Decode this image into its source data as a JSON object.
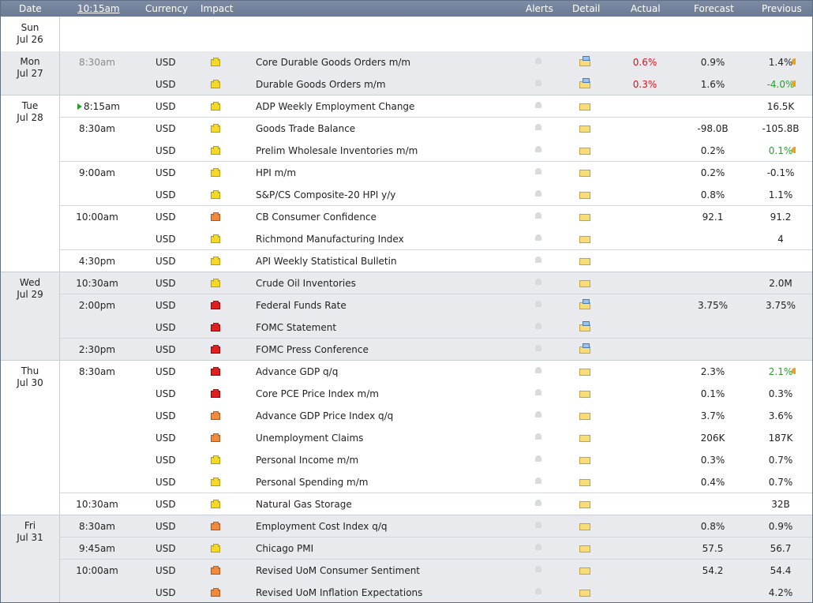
{
  "header": {
    "date": "Date",
    "time": "10:15am",
    "currency": "Currency",
    "impact": "Impact",
    "alerts": "Alerts",
    "detail": "Detail",
    "actual": "Actual",
    "forecast": "Forecast",
    "previous": "Previous"
  },
  "colors": {
    "header_bg": "#7586a0",
    "shade": "#e8eaee",
    "white": "#ffffff",
    "better": "#2aa02a",
    "worse": "#d8141e"
  },
  "days": [
    {
      "day": "Sun",
      "date": "Jul 26"
    },
    {
      "day": "Mon",
      "date": "Jul 27"
    },
    {
      "day": "Tue",
      "date": "Jul 28"
    },
    {
      "day": "Wed",
      "date": "Jul 29"
    },
    {
      "day": "Thu",
      "date": "Jul 30"
    },
    {
      "day": "Fri",
      "date": "Jul 31"
    }
  ],
  "events": [
    {
      "time": "8:30am",
      "time_grey": true,
      "currency": "USD",
      "impact": "yellow",
      "event": "Core Durable Goods Orders m/m",
      "detail": "chart-folder-icon",
      "actual": "0.6%",
      "actual_color": "worse",
      "forecast": "0.9%",
      "previous": "1.4%",
      "previous_color": "",
      "revised_marker": true
    },
    {
      "time": "",
      "currency": "USD",
      "impact": "yellow",
      "event": "Durable Goods Orders m/m",
      "detail": "chart-folder-icon",
      "actual": "0.3%",
      "actual_color": "worse",
      "forecast": "1.6%",
      "previous": "-4.0%",
      "previous_color": "better",
      "revised_marker": true
    },
    {
      "time": "8:15am",
      "time_now_marker": true,
      "currency": "USD",
      "impact": "yellow",
      "event": "ADP Weekly Employment Change",
      "detail": "folder-icon",
      "actual": "",
      "forecast": "",
      "previous": "16.5K"
    },
    {
      "time": "8:30am",
      "currency": "USD",
      "impact": "yellow",
      "event": "Goods Trade Balance",
      "detail": "folder-icon",
      "actual": "",
      "forecast": "-98.0B",
      "previous": "-105.8B"
    },
    {
      "time": "",
      "currency": "USD",
      "impact": "yellow",
      "event": "Prelim Wholesale Inventories m/m",
      "detail": "folder-icon",
      "actual": "",
      "forecast": "0.2%",
      "previous": "0.1%",
      "previous_color": "better",
      "revised_marker": true
    },
    {
      "time": "9:00am",
      "currency": "USD",
      "impact": "yellow",
      "event": "HPI m/m",
      "detail": "folder-icon",
      "actual": "",
      "forecast": "0.2%",
      "previous": "-0.1%"
    },
    {
      "time": "",
      "currency": "USD",
      "impact": "yellow",
      "event": "S&P/CS Composite-20 HPI y/y",
      "detail": "folder-icon",
      "actual": "",
      "forecast": "0.8%",
      "previous": "1.1%"
    },
    {
      "time": "10:00am",
      "currency": "USD",
      "impact": "orange",
      "event": "CB Consumer Confidence",
      "detail": "folder-icon",
      "actual": "",
      "forecast": "92.1",
      "previous": "91.2"
    },
    {
      "time": "",
      "currency": "USD",
      "impact": "yellow",
      "event": "Richmond Manufacturing Index",
      "detail": "folder-icon",
      "actual": "",
      "forecast": "",
      "previous": "4"
    },
    {
      "time": "4:30pm",
      "currency": "USD",
      "impact": "yellow",
      "event": "API Weekly Statistical Bulletin",
      "detail": "folder-icon",
      "actual": "",
      "forecast": "",
      "previous": ""
    },
    {
      "time": "10:30am",
      "currency": "USD",
      "impact": "yellow",
      "event": "Crude Oil Inventories",
      "detail": "folder-icon",
      "actual": "",
      "forecast": "",
      "previous": "2.0M"
    },
    {
      "time": "2:00pm",
      "currency": "USD",
      "impact": "red",
      "event": "Federal Funds Rate",
      "detail": "chart-folder-icon",
      "actual": "",
      "forecast": "3.75%",
      "previous": "3.75%"
    },
    {
      "time": "",
      "currency": "USD",
      "impact": "red",
      "event": "FOMC Statement",
      "detail": "chart-folder-icon",
      "actual": "",
      "forecast": "",
      "previous": ""
    },
    {
      "time": "2:30pm",
      "currency": "USD",
      "impact": "red",
      "event": "FOMC Press Conference",
      "detail": "chart-folder-icon",
      "actual": "",
      "forecast": "",
      "previous": ""
    },
    {
      "time": "8:30am",
      "currency": "USD",
      "impact": "red",
      "event": "Advance GDP q/q",
      "detail": "folder-icon",
      "actual": "",
      "forecast": "2.3%",
      "previous": "2.1%",
      "previous_color": "better",
      "revised_marker": true
    },
    {
      "time": "",
      "currency": "USD",
      "impact": "red",
      "event": "Core PCE Price Index m/m",
      "detail": "folder-icon",
      "actual": "",
      "forecast": "0.1%",
      "previous": "0.3%"
    },
    {
      "time": "",
      "currency": "USD",
      "impact": "orange",
      "event": "Advance GDP Price Index q/q",
      "detail": "folder-icon",
      "actual": "",
      "forecast": "3.7%",
      "previous": "3.6%"
    },
    {
      "time": "",
      "currency": "USD",
      "impact": "orange",
      "event": "Unemployment Claims",
      "detail": "folder-icon",
      "actual": "",
      "forecast": "206K",
      "previous": "187K"
    },
    {
      "time": "",
      "currency": "USD",
      "impact": "yellow",
      "event": "Personal Income m/m",
      "detail": "folder-icon",
      "actual": "",
      "forecast": "0.3%",
      "previous": "0.7%"
    },
    {
      "time": "",
      "currency": "USD",
      "impact": "yellow",
      "event": "Personal Spending m/m",
      "detail": "folder-icon",
      "actual": "",
      "forecast": "0.4%",
      "previous": "0.7%"
    },
    {
      "time": "10:30am",
      "currency": "USD",
      "impact": "yellow",
      "event": "Natural Gas Storage",
      "detail": "folder-icon",
      "actual": "",
      "forecast": "",
      "previous": "32B"
    },
    {
      "time": "8:30am",
      "currency": "USD",
      "impact": "orange",
      "event": "Employment Cost Index q/q",
      "detail": "folder-icon",
      "actual": "",
      "forecast": "0.8%",
      "previous": "0.9%"
    },
    {
      "time": "9:45am",
      "currency": "USD",
      "impact": "yellow",
      "event": "Chicago PMI",
      "detail": "folder-icon",
      "actual": "",
      "forecast": "57.5",
      "previous": "56.7"
    },
    {
      "time": "10:00am",
      "currency": "USD",
      "impact": "orange",
      "event": "Revised UoM Consumer Sentiment",
      "detail": "folder-icon",
      "actual": "",
      "forecast": "54.2",
      "previous": "54.4"
    },
    {
      "time": "",
      "currency": "USD",
      "impact": "orange",
      "event": "Revised UoM Inflation Expectations",
      "detail": "folder-icon",
      "actual": "",
      "forecast": "",
      "previous": "4.2%"
    }
  ]
}
